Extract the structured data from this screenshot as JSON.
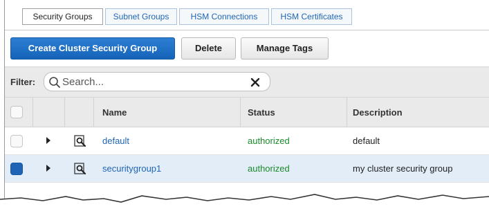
{
  "tabs": [
    {
      "label": "Security Groups",
      "active": true
    },
    {
      "label": "Subnet Groups",
      "active": false
    },
    {
      "label": "HSM Connections",
      "active": false
    },
    {
      "label": "HSM Certificates",
      "active": false
    }
  ],
  "toolbar": {
    "create_label": "Create Cluster Security Group",
    "delete_label": "Delete",
    "manage_tags_label": "Manage Tags"
  },
  "filter": {
    "label": "Filter:",
    "placeholder": "Search...",
    "value": ""
  },
  "table": {
    "headers": {
      "name": "Name",
      "status": "Status",
      "description": "Description"
    },
    "rows": [
      {
        "name": "default",
        "status": "authorized",
        "description": "default",
        "selected": false
      },
      {
        "name": "securitygroup1",
        "status": "authorized",
        "description": "my cluster security group",
        "selected": true
      }
    ]
  },
  "colors": {
    "accent": "#1f65b6",
    "primary_button": "#1463b8",
    "status_ok": "#1a8a2a",
    "selected_row": "#e2edf8"
  },
  "icons": {
    "search": "search-icon",
    "clear": "close-icon",
    "expand": "caret-right-icon",
    "details": "magnifier-details-icon"
  }
}
